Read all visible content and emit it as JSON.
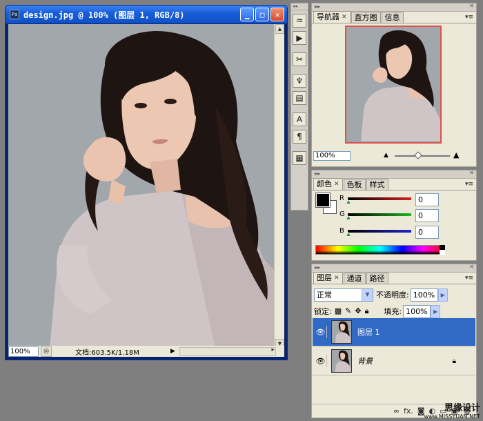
{
  "doc_window": {
    "title": "design.jpg @ 100% (图层 1, RGB/8)",
    "app_icon": "Ps",
    "status": {
      "zoom": "100%",
      "doc_info": "文档:603.5K/1.18M",
      "arrow": "▶"
    }
  },
  "navigator_panel": {
    "tabs": [
      {
        "label": "导航器",
        "active": true
      },
      {
        "label": "直方图",
        "active": false
      },
      {
        "label": "信息",
        "active": false
      }
    ],
    "zoom": "100%"
  },
  "color_panel": {
    "tabs": [
      {
        "label": "颜色",
        "active": true
      },
      {
        "label": "色板",
        "active": false
      },
      {
        "label": "样式",
        "active": false
      }
    ],
    "channels": [
      {
        "label": "R",
        "value": "0",
        "color": "#d42020"
      },
      {
        "label": "G",
        "value": "0",
        "color": "#22b422"
      },
      {
        "label": "B",
        "value": "0",
        "color": "#2020d4"
      }
    ],
    "foreground_color": "#000000",
    "background_color": "#ffffff"
  },
  "layers_panel": {
    "tabs": [
      {
        "label": "图层",
        "active": true
      },
      {
        "label": "通道",
        "active": false
      },
      {
        "label": "路径",
        "active": false
      }
    ],
    "blend_mode": "正常",
    "opacity_label": "不透明度:",
    "opacity": "100%",
    "lock_label": "锁定:",
    "fill_label": "填充:",
    "fill": "100%",
    "layers": [
      {
        "name": "图层 1",
        "selected": true,
        "locked": false
      },
      {
        "name": "背景",
        "selected": false,
        "locked": true
      }
    ],
    "footer_fx": "fx."
  },
  "watermark": {
    "title": "思缘设计",
    "site": "www.MISSYUAN.NET"
  }
}
